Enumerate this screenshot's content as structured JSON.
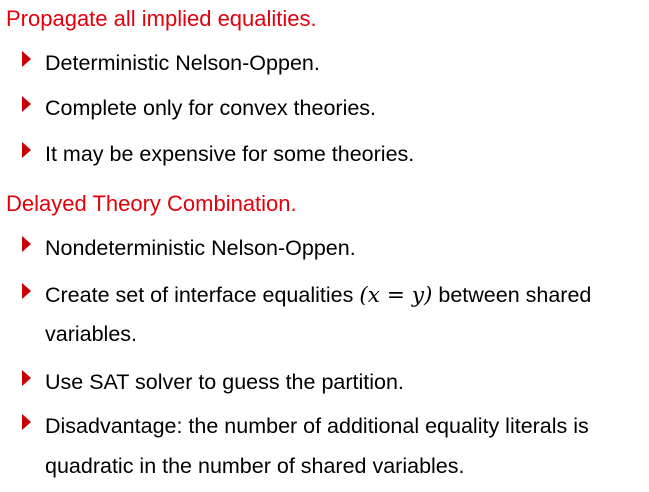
{
  "sections": [
    {
      "heading": "Propagate all implied equalities.",
      "bullets": [
        "Deterministic Nelson-Oppen.",
        "Complete only for convex theories.",
        "It may be expensive for some theories."
      ]
    },
    {
      "heading": "Delayed Theory Combination.",
      "bullets": [
        "Nondeterministic Nelson-Oppen.",
        {
          "before": "Create set of interface equalities ",
          "math_open": "(",
          "math_x": "x",
          "math_eq": "=",
          "math_y": "y",
          "math_close": ")",
          "after": " between shared",
          "line2": "variables."
        },
        "Use SAT solver to guess the partition.",
        {
          "line1": "Disadvantage: the number of additional equality literals is",
          "line2": "quadratic in the number of shared variables."
        }
      ]
    }
  ],
  "colors": {
    "heading": "#e3000b",
    "bullet": "#c00000",
    "text": "#000000"
  },
  "icons": {
    "bullet": "red-triangle-bullet-icon"
  }
}
